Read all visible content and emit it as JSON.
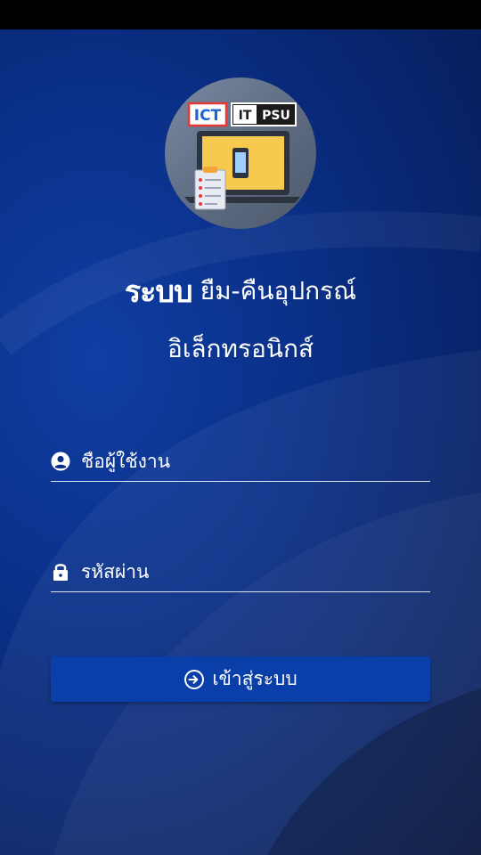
{
  "app": {
    "logo": {
      "badge_left": "ICT",
      "badge_right_1": "IT",
      "badge_right_2": "PSU",
      "icon": "laptop-phone-clipboard-logo"
    },
    "title": {
      "brand": "ระบบ",
      "line1_rest": "ยืม-คืนอุปกรณ์",
      "line2": "อิเล็กทรอนิกส์"
    }
  },
  "form": {
    "username": {
      "placeholder": "ชื่อผู้ใช้งาน",
      "value": "",
      "icon": "user-circle-icon"
    },
    "password": {
      "placeholder": "รหัสผ่าน",
      "value": "",
      "icon": "lock-icon"
    },
    "login_button": {
      "label": "เข้าสู่ระบบ",
      "icon": "sign-in-icon"
    }
  },
  "colors": {
    "background": "#0a2f86",
    "button": "#0a3ea8",
    "text": "#ffffff"
  }
}
